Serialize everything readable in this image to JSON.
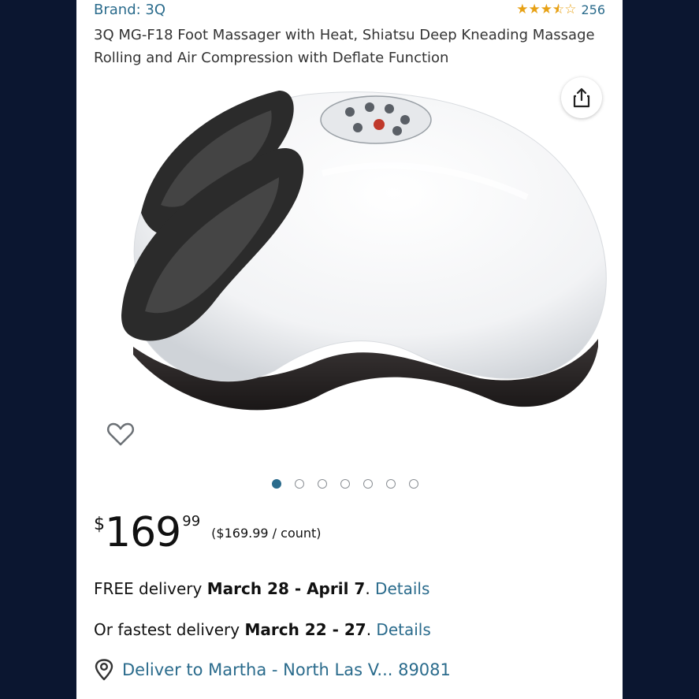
{
  "product": {
    "brand": "Brand: 3Q",
    "rating_count": "256",
    "rating": 3.5,
    "title": "3Q MG-F18 Foot Massager with Heat, Shiatsu Deep Kneading Massage Rolling and Air Compression with Deflate Function"
  },
  "gallery": {
    "image_icon": "foot-massager-image",
    "total_images": 7,
    "current_image": 1
  },
  "price": {
    "currency": "$",
    "whole": "169",
    "fraction": "99",
    "unit_price": "($169.99 / count)"
  },
  "delivery": {
    "free_prefix": "FREE delivery ",
    "free_dates": "March 28 - April 7",
    "free_suffix": ". ",
    "free_details": "Details",
    "fast_prefix": "Or fastest delivery ",
    "fast_dates": "March 22 - 27",
    "fast_suffix": ". ",
    "fast_details": "Details"
  },
  "location": {
    "text": "Deliver to Martha - North Las V... 89081",
    "icon": "location-pin-icon"
  },
  "colors": {
    "link": "#2a6b8c",
    "star": "#e7a115",
    "background": "#0b1630"
  }
}
